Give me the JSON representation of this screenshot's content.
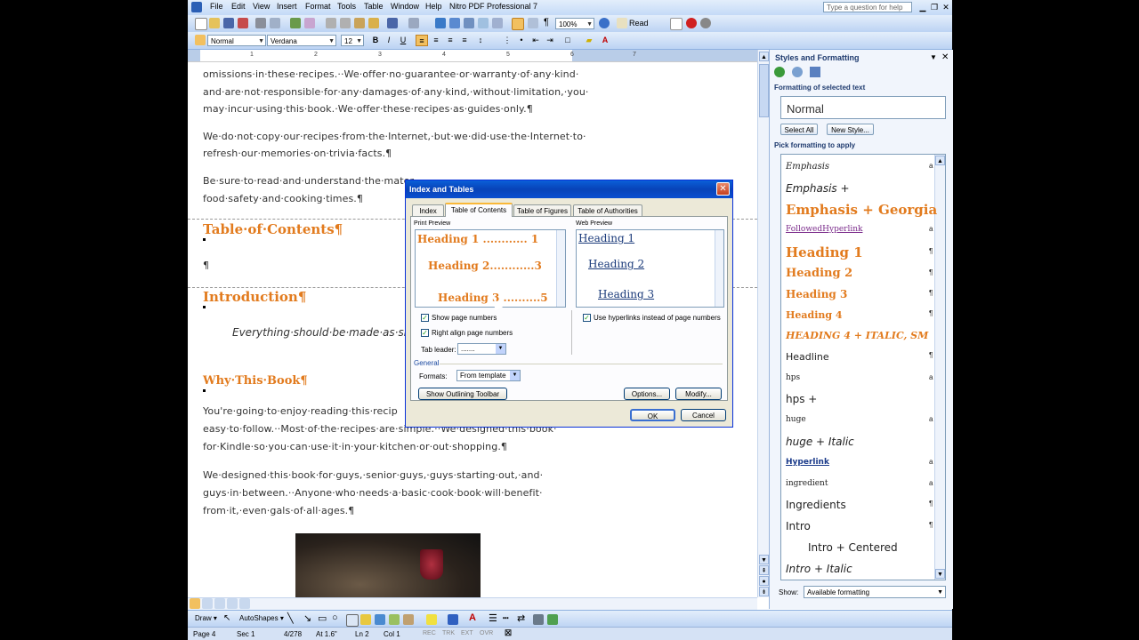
{
  "menubar": {
    "items": [
      "File",
      "Edit",
      "View",
      "Insert",
      "Format",
      "Tools",
      "Table",
      "Window",
      "Help",
      "Nitro PDF Professional 7"
    ],
    "help_placeholder": "Type a question for help"
  },
  "toolbar": {
    "zoom": "100%",
    "read_label": "Read"
  },
  "formatting": {
    "style": "Normal",
    "font": "Verdana",
    "size": "12"
  },
  "ruler": {
    "marks": [
      "1",
      "2",
      "3",
      "4",
      "5",
      "6",
      "7"
    ]
  },
  "document": {
    "p1": [
      "omissions·in·these·recipes.··We·offer·no·guarantee·or·warranty·of·any·kind·",
      "and·are·not·responsible·for·any·damages·of·any·kind,·without·limitation,·you·",
      "may·incur·using·this·book.·We·offer·these·recipes·as·guides·only.¶"
    ],
    "p2": [
      "We·do·not·copy·our·recipes·from·the·Internet,·but·we·did·use·the·Internet·to·",
      "refresh·our·memories·on·trivia·facts.¶"
    ],
    "p3": [
      "Be·sure·to·read·and·understand·the·mater",
      "food·safety·and·cooking·times.¶"
    ],
    "toc_heading": "Table·of·Contents¶",
    "pilcrow": "¶",
    "intro_heading": "Introduction¶",
    "quote": "Everything·should·be·made·as·si",
    "why_heading": "Why·This·Book¶",
    "p4": [
      "You're·going·to·enjoy·reading·this·recip",
      "easy·to·follow.··Most·of·the·recipes·are·simple.··We·designed·this·book·",
      "for·Kindle·so·you·can·use·it·in·your·kitchen·or·out·shopping.¶"
    ],
    "p5": [
      "We·designed·this·book·for·guys,·senior·guys,·guys·starting·out,·and·",
      "guys·in·between.··Anyone·who·needs·a·basic·cook·book·will·benefit·",
      "from·it,·even·gals·of·all·ages.¶"
    ]
  },
  "drawbar": {
    "draw": "Draw ▾",
    "autoshapes": "AutoShapes ▾"
  },
  "status": {
    "page": "Page 4",
    "sec": "Sec 1",
    "pages": "4/278",
    "at": "At 1.6\"",
    "ln": "Ln 2",
    "col": "Col 1",
    "rec": "REC",
    "trk": "TRK",
    "ext": "EXT",
    "ovr": "OVR"
  },
  "pane": {
    "title": "Styles and Formatting",
    "selected_label": "Formatting of selected text",
    "selected": "Normal",
    "select_all": "Select All",
    "new_style": "New Style...",
    "pick_label": "Pick formatting to apply",
    "show_label": "Show:",
    "show_value": "Available formatting",
    "styles": [
      {
        "name": "Emphasis",
        "mark": "a"
      },
      {
        "name": "Emphasis +",
        "mark": ""
      },
      {
        "name": "Emphasis + Georgia",
        "mark": ""
      },
      {
        "name": "FollowedHyperlink",
        "mark": "a"
      },
      {
        "name": "Heading 1",
        "mark": "¶"
      },
      {
        "name": "Heading 2",
        "mark": "¶"
      },
      {
        "name": "Heading 3",
        "mark": "¶"
      },
      {
        "name": "Heading 4",
        "mark": "¶"
      },
      {
        "name": "HEADING 4 + ITALIC, SM",
        "mark": ""
      },
      {
        "name": "Headline",
        "mark": "¶"
      },
      {
        "name": "hps",
        "mark": "a"
      },
      {
        "name": "hps +",
        "mark": ""
      },
      {
        "name": "huge",
        "mark": "a"
      },
      {
        "name": "huge + Italic",
        "mark": ""
      },
      {
        "name": "Hyperlink",
        "mark": "a"
      },
      {
        "name": "ingredient",
        "mark": "a"
      },
      {
        "name": "Ingredients",
        "mark": "¶"
      },
      {
        "name": "Intro",
        "mark": "¶"
      },
      {
        "name": "Intro + Centered",
        "mark": ""
      },
      {
        "name": "Intro + Italic",
        "mark": ""
      }
    ]
  },
  "dialog": {
    "title": "Index and Tables",
    "tabs": [
      "Index",
      "Table of Contents",
      "Table of Figures",
      "Table of Authorities"
    ],
    "print_preview": "Print Preview",
    "web_preview": "Web Preview",
    "print_lines": [
      "Heading 1 ............ 1",
      "Heading 2............3",
      "Heading 3 ..........5"
    ],
    "web_lines": [
      "Heading 1",
      "Heading 2",
      "Heading 3"
    ],
    "show_page_numbers": "Show page numbers",
    "right_align": "Right align page numbers",
    "tab_leader_label": "Tab leader:",
    "tab_leader_value": ".......",
    "use_hyperlinks": "Use hyperlinks instead of page numbers",
    "general": "General",
    "formats_label": "Formats:",
    "formats_value": "From template",
    "show_outlining": "Show Outlining Toolbar",
    "options": "Options...",
    "modify": "Modify...",
    "ok": "OK",
    "cancel": "Cancel"
  }
}
